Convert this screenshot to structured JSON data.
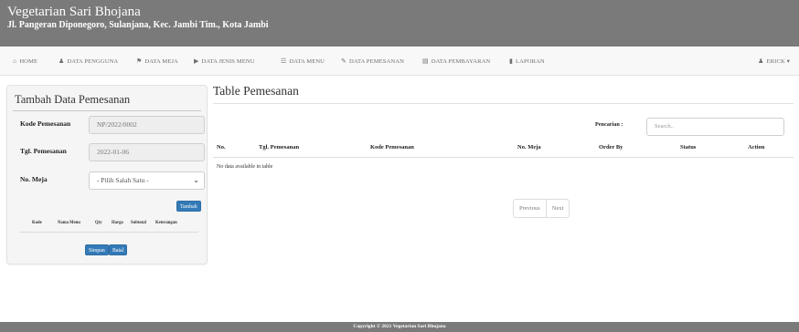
{
  "header": {
    "title": "Vegetarian Sari Bhojana",
    "address": "Jl. Pangeran Diponegoro, Sulanjana, Kec. Jambi Tim., Kota Jambi",
    "background": "#7a7a7a"
  },
  "nav": {
    "items": [
      {
        "label": "HOME",
        "icon": "home-icon"
      },
      {
        "label": "DATA PENGGUNA",
        "icon": "user-icon"
      },
      {
        "label": "DATA MEJA",
        "icon": "tag-icon"
      },
      {
        "label": "DATA JENIS MENU",
        "icon": "bookmark-icon"
      },
      {
        "label": "DATA MENU",
        "icon": "cutlery-icon"
      },
      {
        "label": "DATA PEMESANAN",
        "icon": "pencil-icon"
      },
      {
        "label": "DATA PEMBAYARAN",
        "icon": "credit-card-icon"
      },
      {
        "label": "LAPORAN",
        "icon": "file-icon"
      }
    ],
    "user_label": "ERICK",
    "user_icon": "user-icon"
  },
  "form": {
    "title": "Tambah Data Pemesanan",
    "kode_label": "Kode Pemesanan",
    "kode_value": "NP/2022/0002",
    "tgl_label": "Tgl. Pemesanan",
    "tgl_value": "2022-01-06",
    "meja_label": "No. Meja",
    "meja_selected": "- Pilih Salah Satu -",
    "tambah_label": "Tambah",
    "columns": [
      "Kode",
      "Nama Menu",
      "Qty",
      "Harga",
      "Subtotal",
      "Keterangan"
    ],
    "simpan_label": "Simpan",
    "batal_label": "Batal",
    "button_color": "#337ab7"
  },
  "table": {
    "title": "Table Pemesanan",
    "search_label": "Pencarian :",
    "search_placeholder": "Search..",
    "columns": [
      "No.",
      "Tgl. Pemesanan",
      "Kode Pemesanan",
      "No. Meja",
      "Order By",
      "Status",
      "Action"
    ],
    "empty_text": "No data available in table",
    "prev_label": "Previous",
    "next_label": "Next"
  },
  "footer": {
    "text": "Copyright © 2021 Vegetarian Sari Bhojana"
  }
}
